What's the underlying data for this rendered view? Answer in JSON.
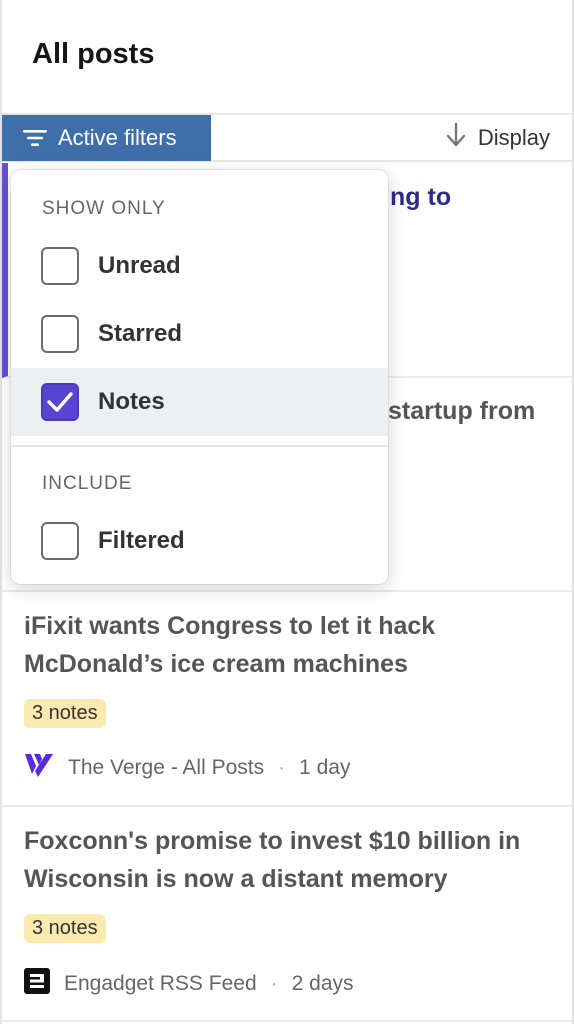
{
  "header": {
    "title": "All posts"
  },
  "toolbar": {
    "filters_label": "Active filters",
    "display_label": "Display"
  },
  "dropdown": {
    "show_only_label": "SHOW ONLY",
    "show_only_options": [
      {
        "label": "Unread",
        "checked": false
      },
      {
        "label": "Starred",
        "checked": false
      },
      {
        "label": "Notes",
        "checked": true
      }
    ],
    "include_label": "INCLUDE",
    "include_options": [
      {
        "label": "Filtered",
        "checked": false
      }
    ]
  },
  "posts": [
    {
      "title_visible": "ng to"
    },
    {
      "title_visible": "startup from"
    },
    {
      "title": "iFixit wants Congress to let it hack McDonald’s ice cream machines",
      "notes": "3 notes",
      "source": "The Verge - All Posts",
      "age": "1 day"
    },
    {
      "title": "Foxconn's promise to invest $10 billion in Wisconsin is now a distant memory",
      "notes": "3 notes",
      "source": "Engadget RSS Feed",
      "age": "2 days"
    }
  ],
  "colors": {
    "accent": "#5a44d2",
    "filter_button": "#3f6fa8",
    "notes_badge": "#fbeab0",
    "unread_title": "#2e2a8a"
  }
}
